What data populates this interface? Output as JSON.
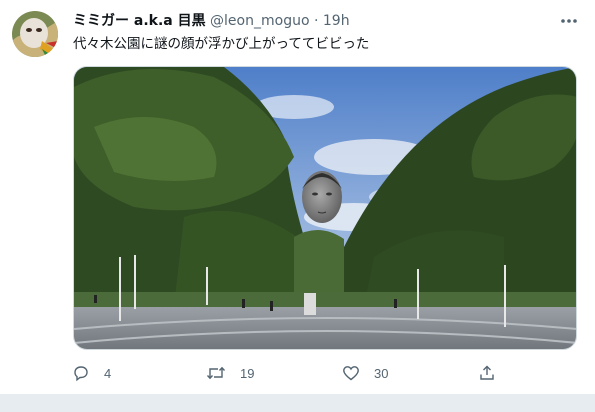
{
  "tweet": {
    "display_name": "ミミガー a.k.a 目黒",
    "handle": "@leon_moguo",
    "separator": "·",
    "time": "19h",
    "text": "代々木公園に謎の顔が浮かび上がっててビビった"
  },
  "actions": {
    "reply_count": "4",
    "retweet_count": "19",
    "like_count": "30"
  },
  "icons": [
    "more-icon",
    "reply-icon",
    "retweet-icon",
    "like-icon",
    "share-icon"
  ],
  "colors": {
    "text": "#0f1419",
    "secondary": "#536471",
    "background": "#e6ecf0"
  }
}
